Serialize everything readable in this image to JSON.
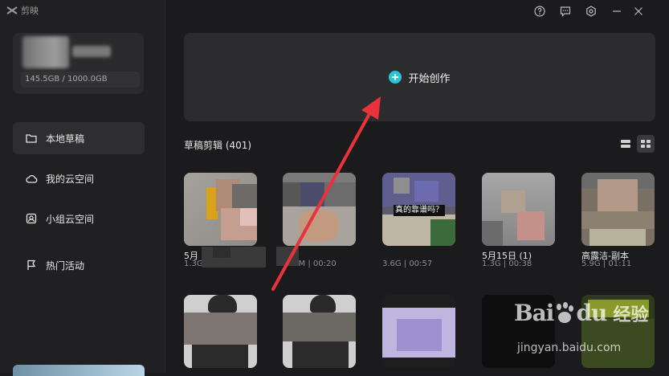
{
  "app": {
    "name": "剪映"
  },
  "profile": {
    "storage": "145.5GB / 1000.0GB"
  },
  "sidebar": {
    "items": [
      {
        "label": "本地草稿",
        "icon": "folder-icon",
        "active": true
      },
      {
        "label": "我的云空间",
        "icon": "cloud-icon",
        "active": false
      },
      {
        "label": "小组云空间",
        "icon": "team-cloud-icon",
        "active": false
      },
      {
        "label": "热门活动",
        "icon": "flag-icon",
        "active": false
      }
    ]
  },
  "topbar": {
    "icons": [
      "help-icon",
      "feedback-icon",
      "settings-icon",
      "minimize-icon",
      "close-icon"
    ]
  },
  "create": {
    "label": "开始创作"
  },
  "drafts": {
    "title": "草稿剪辑 (401)",
    "cards": [
      {
        "title": "5月",
        "meta": "1.3G"
      },
      {
        "title": "",
        "meta": ".2M | 00:20"
      },
      {
        "title": "",
        "meta": "3.6G | 00:57",
        "overlay_text": "真的靠谱吗？"
      },
      {
        "title": "5月15日 (1)",
        "meta": "1.3G | 00:38"
      },
      {
        "title": "高露洁-副本",
        "meta": "5.9G | 01:11"
      },
      {
        "title": "",
        "meta": ""
      },
      {
        "title": "",
        "meta": ""
      },
      {
        "title": "",
        "meta": ""
      },
      {
        "title": "",
        "meta": ""
      },
      {
        "title": "",
        "meta": ""
      }
    ]
  },
  "watermark": {
    "brand": "Bai",
    "brand2": "du",
    "cn": "经验",
    "url": "jingyan.baidu.com"
  },
  "colors": {
    "accent": "#25c6d6",
    "annotation_arrow": "#e8333a"
  }
}
